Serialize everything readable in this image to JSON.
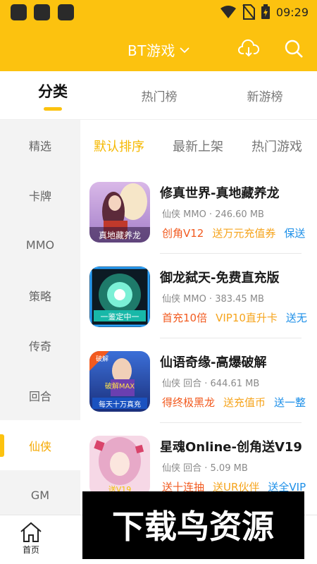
{
  "status_bar": {
    "time": "09:29"
  },
  "header": {
    "title": "BT游戏",
    "bg_color": "#FCC20F",
    "icons": [
      "download-cloud-icon",
      "search-icon"
    ]
  },
  "top_tabs": [
    {
      "label": "分类",
      "active": true
    },
    {
      "label": "热门榜",
      "active": false
    },
    {
      "label": "新游榜",
      "active": false
    }
  ],
  "sidebar": {
    "items": [
      {
        "label": "精选"
      },
      {
        "label": "卡牌"
      },
      {
        "label": "MMO"
      },
      {
        "label": "策略"
      },
      {
        "label": "传奇"
      },
      {
        "label": "回合"
      },
      {
        "label": "仙侠",
        "active": true
      },
      {
        "label": "GM"
      }
    ]
  },
  "sort_tabs": [
    {
      "label": "默认排序",
      "active": true
    },
    {
      "label": "最新上架"
    },
    {
      "label": "热门游戏"
    }
  ],
  "games": [
    {
      "name": "修真世界-真地藏养龙",
      "meta": "仙侠 MMO · 246.60 MB",
      "icon_text": "真地藏养龙",
      "tags": [
        {
          "text": "创角V12",
          "color": "red"
        },
        {
          "text": "送万元充值券",
          "color": "orange"
        },
        {
          "text": "保送",
          "color": "blue"
        }
      ]
    },
    {
      "name": "御龙弑天-免费直充版",
      "meta": "仙侠 MMO · 383.45 MB",
      "icon_text": "一鉴定中一",
      "tags": [
        {
          "text": "首充10倍",
          "color": "red"
        },
        {
          "text": "VIP10直升卡",
          "color": "orange"
        },
        {
          "text": "送无",
          "color": "blue"
        }
      ]
    },
    {
      "name": "仙语奇缘-高爆破解",
      "meta": "仙侠 回合 · 644.61 MB",
      "icon_text": "破解MAX",
      "icon_text2": "每天十万真充",
      "icon_badge": "破解",
      "tags": [
        {
          "text": "得终极黑龙",
          "color": "red"
        },
        {
          "text": "送充值币",
          "color": "orange"
        },
        {
          "text": "送一整",
          "color": "blue"
        }
      ]
    },
    {
      "name": "星魂Online-创角送V19",
      "meta": "仙侠 回合 · 5.09 MB",
      "icon_text": "送V19",
      "tags": [
        {
          "text": "送十连抽",
          "color": "red"
        },
        {
          "text": "送UR伙伴",
          "color": "orange"
        },
        {
          "text": "送全VIP",
          "color": "blue"
        }
      ]
    }
  ],
  "bottom_nav": {
    "home_label": "首页"
  },
  "watermark": {
    "text": "下载鸟资源"
  },
  "colors": {
    "accent": "#FCC20F",
    "active_text": "#F5A800",
    "tag_red": "#F25A1F",
    "tag_orange": "#F6A41C",
    "tag_blue": "#1C8FE8"
  }
}
